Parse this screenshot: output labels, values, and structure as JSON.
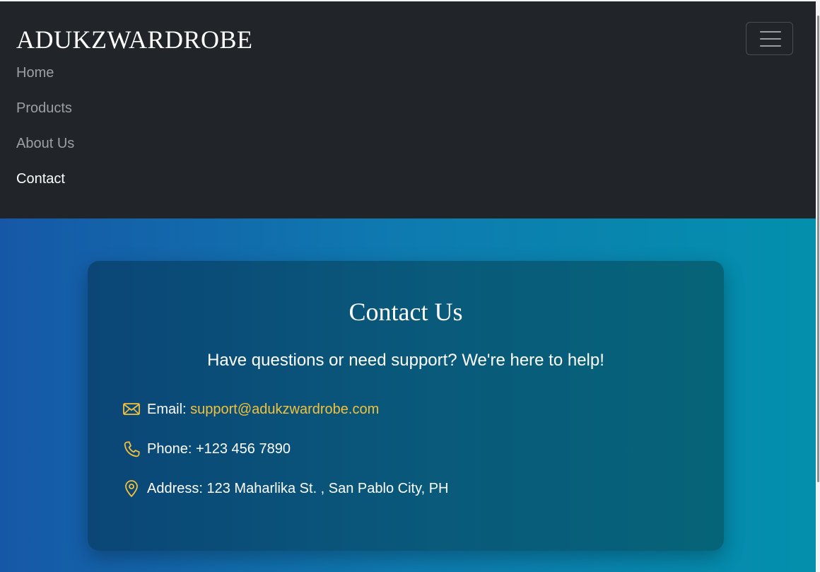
{
  "navbar": {
    "brand": "ADUKZWARDROBE",
    "toggler_icon": "hamburger-menu-icon",
    "links": [
      {
        "label": "Home",
        "active": false
      },
      {
        "label": "Products",
        "active": false
      },
      {
        "label": "About Us",
        "active": false
      },
      {
        "label": "Contact",
        "active": true
      }
    ]
  },
  "contact": {
    "title": "Contact Us",
    "subtitle": "Have questions or need support? We're here to help!",
    "email": {
      "icon": "envelope-icon",
      "label": "Email: ",
      "value": "support@adukzwardrobe.com"
    },
    "phone": {
      "icon": "phone-icon",
      "label": "Phone: ",
      "value": "+123 456 7890"
    },
    "address": {
      "icon": "location-pin-icon",
      "label": "Address: ",
      "value": "123 Maharlika St. , San Pablo City, PH"
    }
  },
  "colors": {
    "navbar_bg": "#212529",
    "accent": "#f3c13a",
    "hero_gradient_start": "#1658a7",
    "hero_gradient_end": "#0390ad",
    "nav_link": "#9ca0a5",
    "nav_link_active": "#ffffff"
  }
}
